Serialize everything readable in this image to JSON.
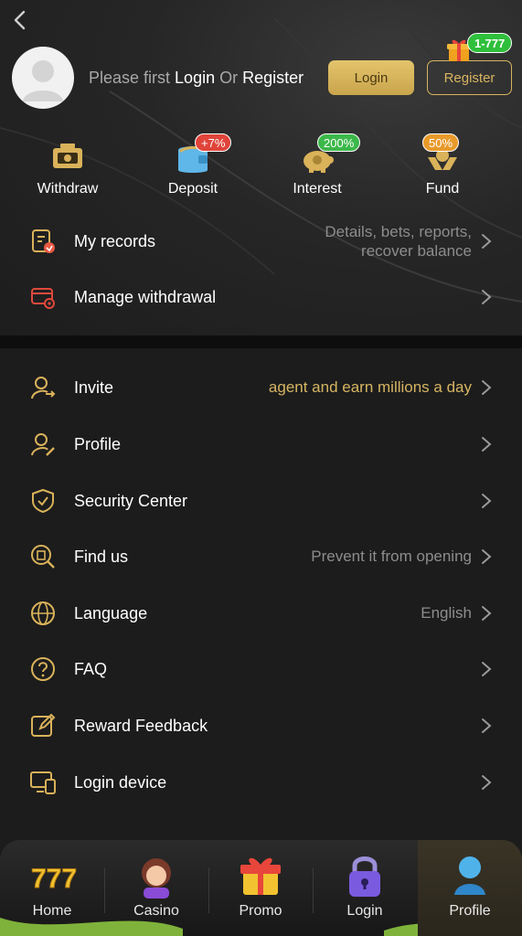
{
  "header": {
    "login_prompt": {
      "prefix": "Please first ",
      "login_word": "Login",
      "middle": " Or ",
      "register_word": "Register"
    },
    "login_button": "Login",
    "register_button": "Register",
    "reward_badge": "1-777",
    "avatar_icon": "default-user-avatar"
  },
  "quick_actions": [
    {
      "label": "Withdraw",
      "icon": "ticket-cash-icon",
      "badge": ""
    },
    {
      "label": "Deposit",
      "icon": "wallet-icon",
      "badge": "+7%",
      "badge_color": "#e0443a"
    },
    {
      "label": "Interest",
      "icon": "piggy-bank-icon",
      "badge": "200%",
      "badge_color": "#3cb84a"
    },
    {
      "label": "Fund",
      "icon": "hands-coin-icon",
      "badge": "50%",
      "badge_color": "#e89a2a"
    }
  ],
  "records_section": [
    {
      "label": "My records",
      "icon": "records-icon",
      "desc_line1": "Details, bets, reports,",
      "desc_line2": "recover balance"
    },
    {
      "label": "Manage withdrawal",
      "icon": "card-settings-icon",
      "desc": ""
    }
  ],
  "menu": [
    {
      "label": "Invite",
      "icon": "invite-user-icon",
      "desc": "agent and earn millions a day"
    },
    {
      "label": "Profile",
      "icon": "user-edit-icon",
      "desc": ""
    },
    {
      "label": "Security Center",
      "icon": "shield-check-icon",
      "desc": ""
    },
    {
      "label": "Find us",
      "icon": "find-building-icon",
      "desc": "Prevent it from opening"
    },
    {
      "label": "Language",
      "icon": "globe-icon",
      "desc": "English"
    },
    {
      "label": "FAQ",
      "icon": "question-circle-icon",
      "desc": ""
    },
    {
      "label": "Reward Feedback",
      "icon": "edit-square-icon",
      "desc": ""
    },
    {
      "label": "Login device",
      "icon": "devices-icon",
      "desc": ""
    }
  ],
  "bottom_nav": [
    {
      "label": "Home",
      "icon": "slot-777-icon",
      "active": false
    },
    {
      "label": "Casino",
      "icon": "dealer-girl-icon",
      "active": false
    },
    {
      "label": "Promo",
      "icon": "gift-box-icon",
      "active": false
    },
    {
      "label": "Login",
      "icon": "padlock-icon",
      "active": false
    },
    {
      "label": "Profile",
      "icon": "user-bust-icon",
      "active": true
    }
  ],
  "colors": {
    "accent_gold": "#d8b460",
    "background": "#1c1c1c",
    "text_muted": "#8d8d8d"
  }
}
